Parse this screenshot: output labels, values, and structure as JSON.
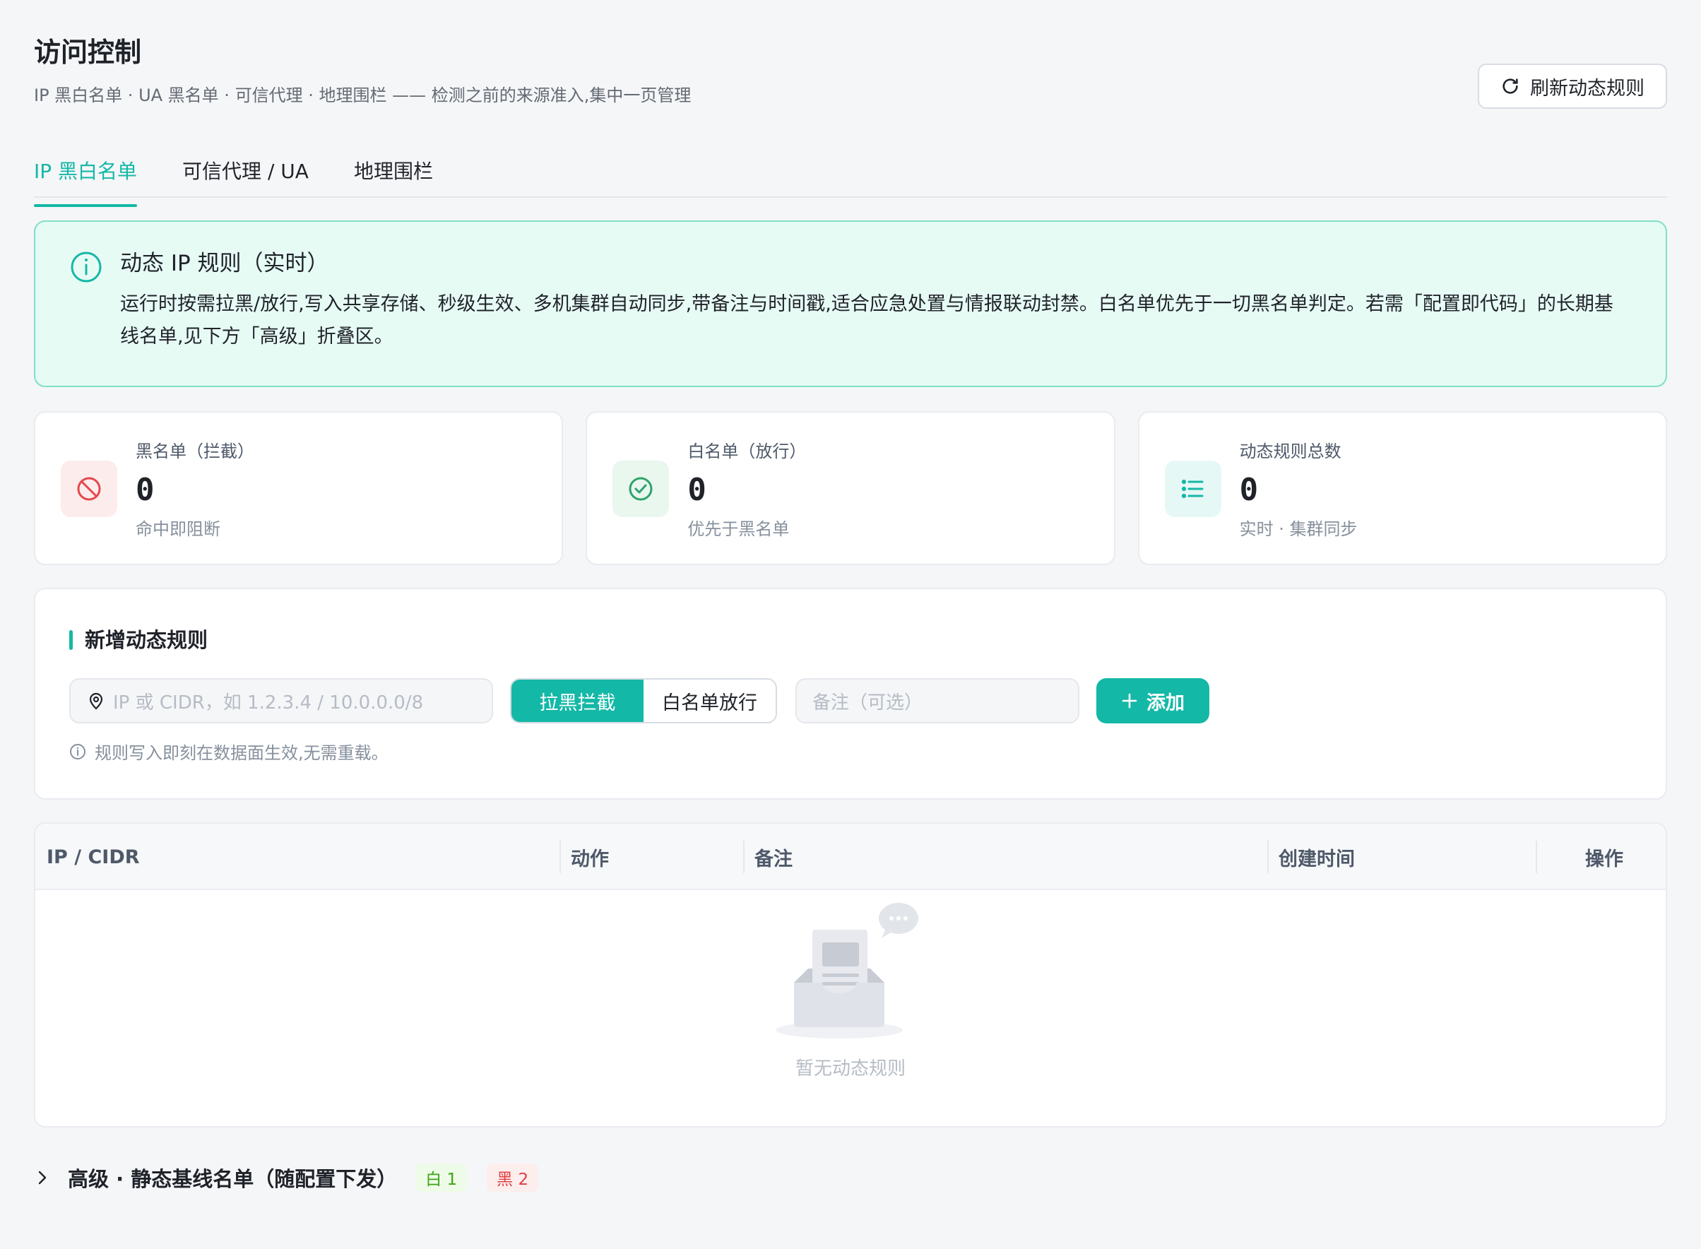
{
  "header": {
    "title": "访问控制",
    "subtitle": "IP 黑白名单 · UA 黑名单 · 可信代理 · 地理围栏 —— 检测之前的来源准入,集中一页管理",
    "refresh_label": "刷新动态规则"
  },
  "tabs": [
    {
      "label": "IP 黑白名单",
      "active": true
    },
    {
      "label": "可信代理 / UA",
      "active": false
    },
    {
      "label": "地理围栏",
      "active": false
    }
  ],
  "banner": {
    "title": "动态 IP 规则（实时）",
    "text": "运行时按需拉黑/放行,写入共享存储、秒级生效、多机集群自动同步,带备注与时间戳,适合应急处置与情报联动封禁。白名单优先于一切黑名单判定。若需「配置即代码」的长期基线名单,见下方「高级」折叠区。"
  },
  "stats": [
    {
      "label": "黑名单（拦截）",
      "value": "0",
      "sub": "命中即阻断",
      "icon": "ban-icon",
      "color": "#e5484d"
    },
    {
      "label": "白名单（放行）",
      "value": "0",
      "sub": "优先于黑名单",
      "icon": "check-circle-icon",
      "color": "#2fa36b"
    },
    {
      "label": "动态规则总数",
      "value": "0",
      "sub": "实时 · 集群同步",
      "icon": "list-icon",
      "color": "#14b8a6"
    }
  ],
  "new_rule": {
    "title": "新增动态规则",
    "ip_placeholder": "IP 或 CIDR，如 1.2.3.4 / 10.0.0.0/8",
    "action_block": "拉黑拦截",
    "action_allow": "白名单放行",
    "note_placeholder": "备注（可选）",
    "add_label": "添加",
    "hint": "规则写入即刻在数据面生效,无需重载。"
  },
  "table": {
    "columns": [
      "IP / CIDR",
      "动作",
      "备注",
      "创建时间",
      "操作"
    ],
    "empty_text": "暂无动态规则"
  },
  "advanced": {
    "title": "高级 · 静态基线名单（随配置下发）",
    "white_tag": "白 1",
    "black_tag": "黑 2"
  },
  "colors": {
    "accent": "#14b8a6"
  }
}
